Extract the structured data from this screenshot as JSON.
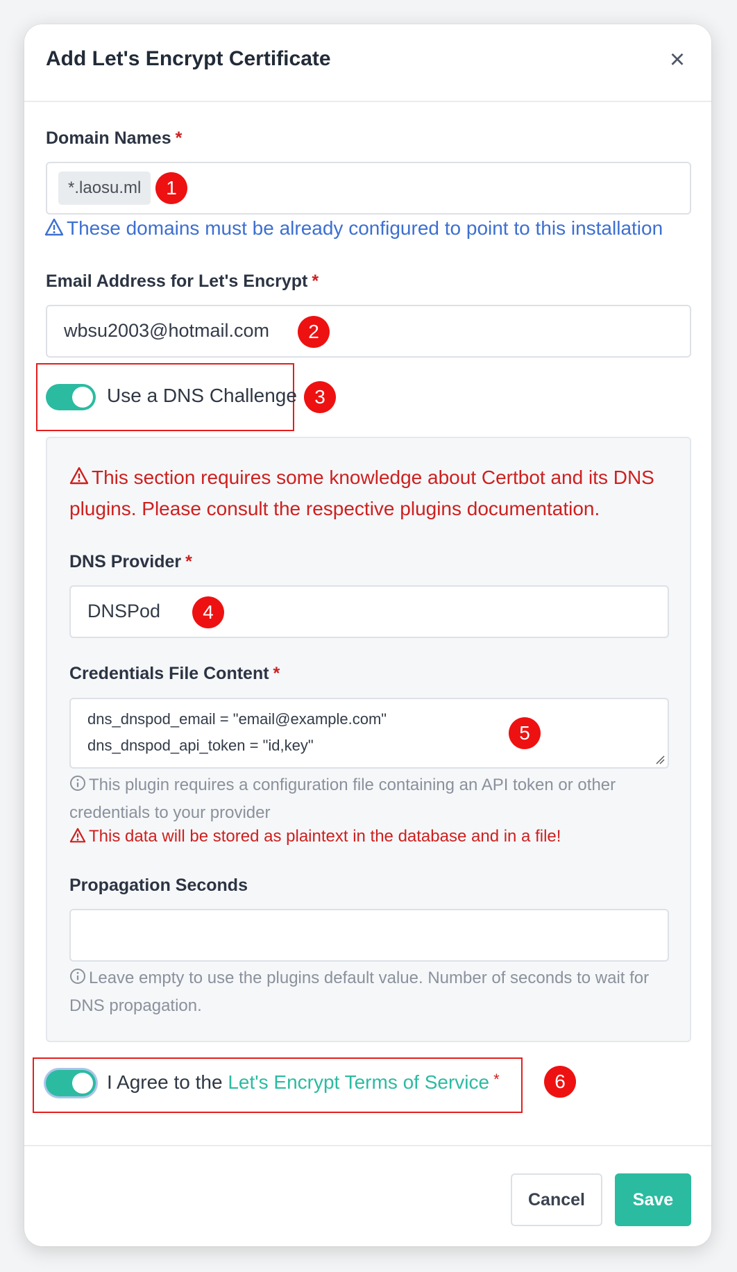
{
  "modal": {
    "title": "Add Let's Encrypt Certificate",
    "close_icon": "×"
  },
  "domain": {
    "label": "Domain Names",
    "required": "*",
    "chip": "*.laosu.ml",
    "hint": "These domains must be already configured to point to this installation"
  },
  "email": {
    "label": "Email Address for Let's Encrypt",
    "required": "*",
    "value": "wbsu2003@hotmail.com"
  },
  "dns_challenge": {
    "label": "Use a DNS Challenge",
    "enabled": true
  },
  "dns_section": {
    "warning": "This section requires some knowledge about Certbot and its DNS plugins. Please consult the respective plugins documentation.",
    "provider_label": "DNS Provider",
    "provider_required": "*",
    "provider_value": "DNSPod",
    "credentials_label": "Credentials File Content",
    "credentials_required": "*",
    "credentials_line1": "dns_dnspod_email = \"email@example.com\"",
    "credentials_line2": "dns_dnspod_api_token = \"id,key\"",
    "credentials_help": "This plugin requires a configuration file containing an API token or other credentials to your provider",
    "credentials_warning": "This data will be stored as plaintext in the database and in a file!",
    "propagation_label": "Propagation Seconds",
    "propagation_value": "",
    "propagation_help": "Leave empty to use the plugins default value. Number of seconds to wait for DNS propagation."
  },
  "agree": {
    "prefix": "I Agree to the",
    "link": "Let's Encrypt Terms of Service",
    "required": "*",
    "enabled": true
  },
  "buttons": {
    "cancel": "Cancel",
    "save": "Save"
  },
  "annotations": [
    "1",
    "2",
    "3",
    "4",
    "5",
    "6"
  ],
  "colors": {
    "accent": "#2bbba1",
    "danger": "#cd201f",
    "info": "#3c6fd1",
    "marker": "#ee1111"
  },
  "icons": {
    "hint": "warning-triangle-icon",
    "help": "info-circle-icon",
    "resize": "resize-grip-icon"
  }
}
